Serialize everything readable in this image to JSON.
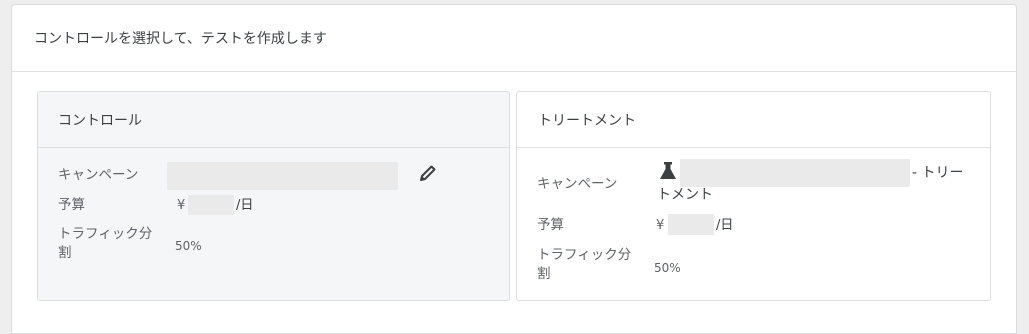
{
  "header": {
    "title": "コントロールを選択して、テストを作成します"
  },
  "control": {
    "title": "コントロール",
    "campaign_label": "キャンペーン",
    "budget_label": "予算",
    "budget_currency": "¥",
    "budget_unit": "/日",
    "traffic_label_line1": "トラフィック分",
    "traffic_label_line2": "割",
    "traffic_value": "50%",
    "edit_icon": "pencil-icon"
  },
  "treatment": {
    "title": "トリートメント",
    "campaign_label": "キャンペーン",
    "campaign_suffix_line1": "- トリー",
    "campaign_suffix_line2": "トメント",
    "budget_label": "予算",
    "budget_currency": "¥",
    "budget_unit": "/日",
    "traffic_label_line1": "トラフィック分",
    "traffic_label_line2": "割",
    "traffic_value": "50%",
    "experiment_icon": "flask-icon"
  }
}
